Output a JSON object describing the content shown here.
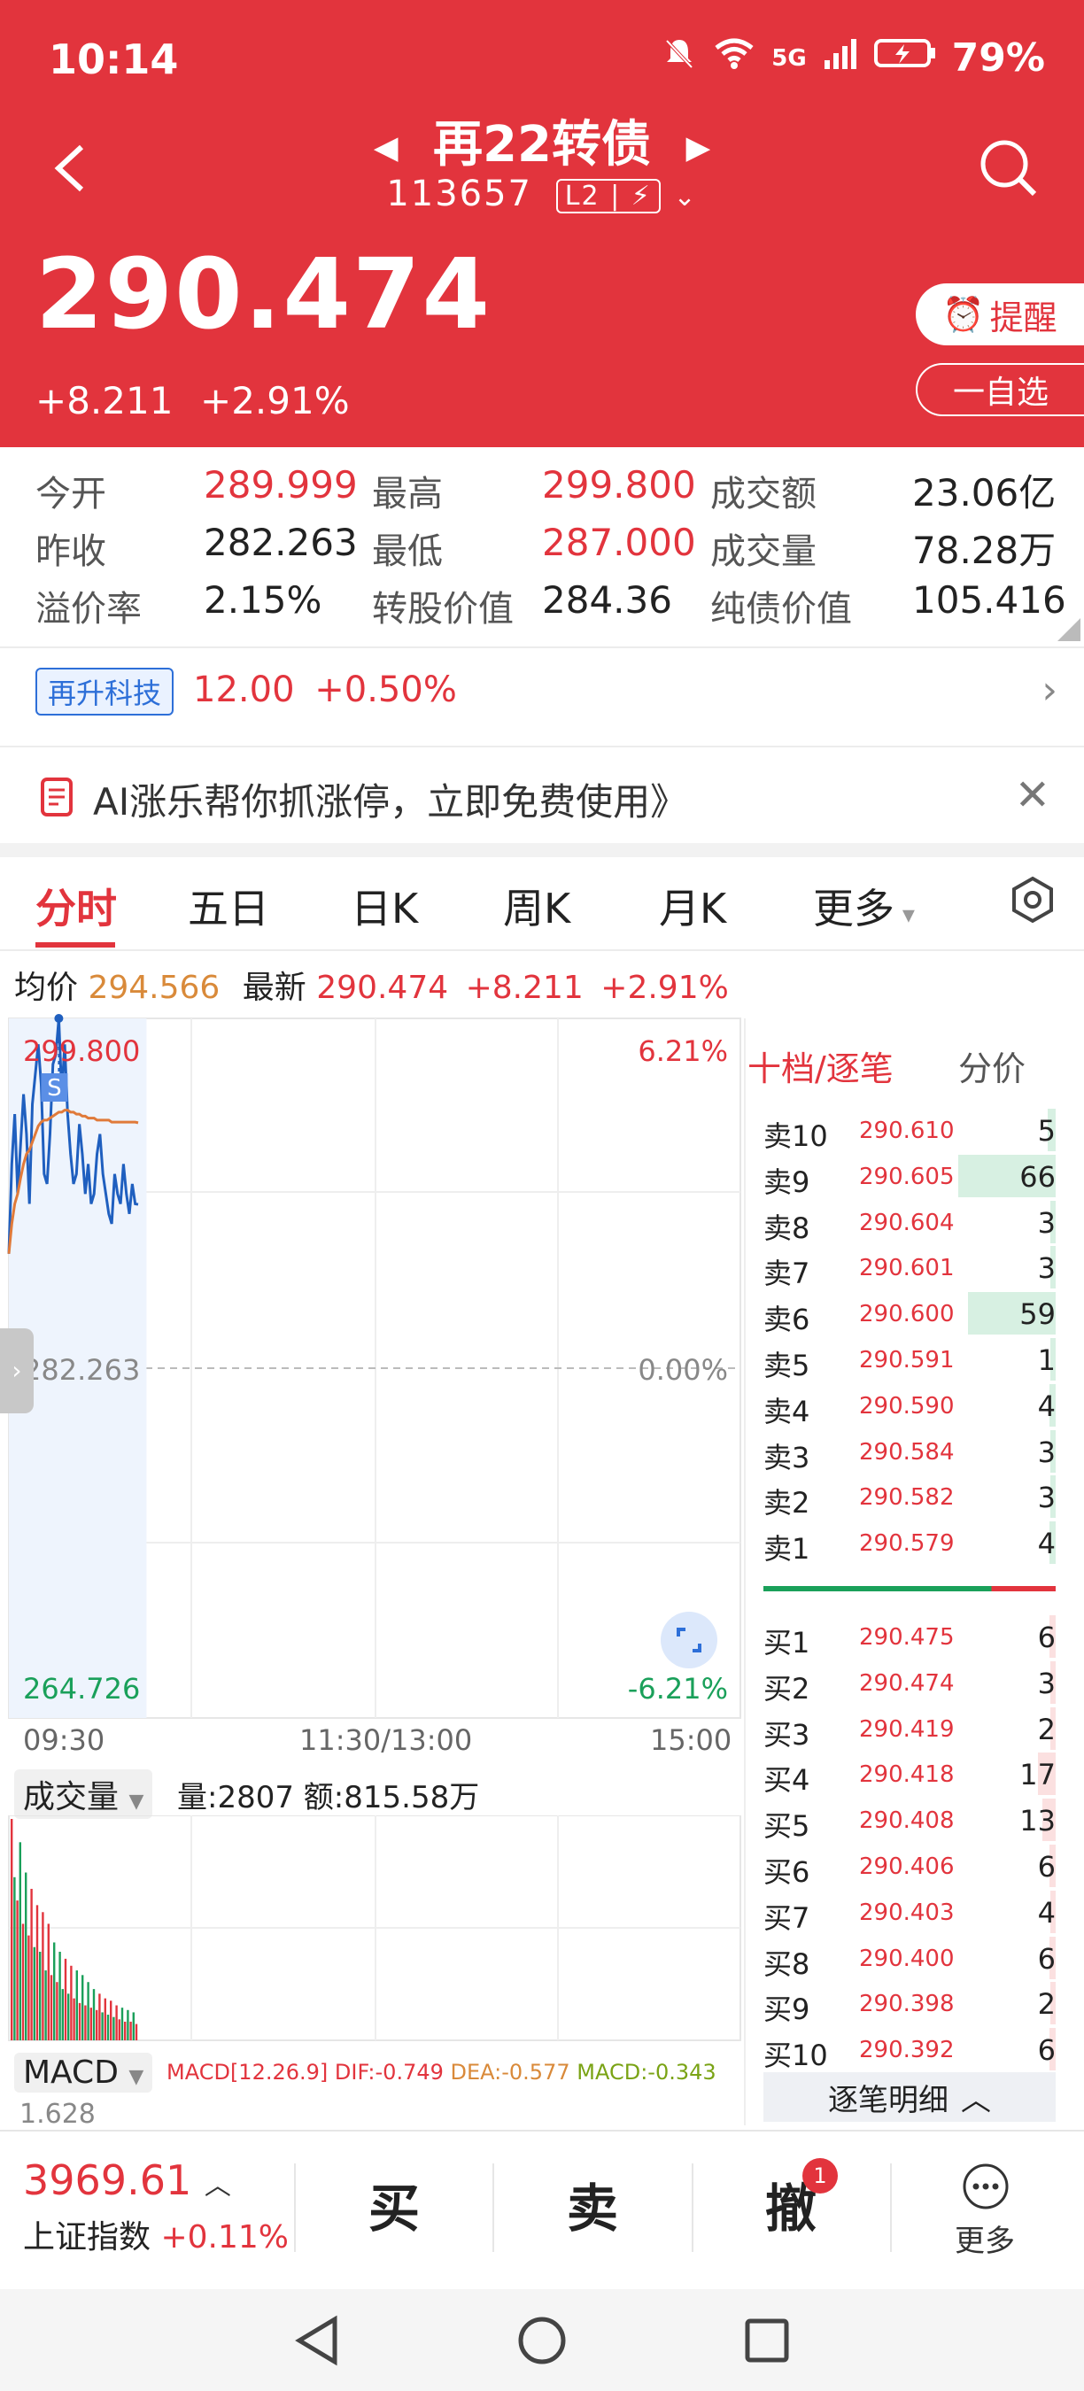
{
  "status": {
    "time": "10:14",
    "battery": "79%",
    "network": "5G"
  },
  "header": {
    "title": "再22转债",
    "code": "113657",
    "level_badge": "L2",
    "price": "290.474",
    "change": "+8.211",
    "change_pct": "+2.91%",
    "remind_label": "提醒",
    "watch_label": "一自选"
  },
  "stats": [
    {
      "label": "今开",
      "value": "289.999",
      "color": "red"
    },
    {
      "label": "最高",
      "value": "299.800",
      "color": "red"
    },
    {
      "label": "成交额",
      "value": "23.06亿",
      "color": "black"
    },
    {
      "label": "昨收",
      "value": "282.263",
      "color": "black"
    },
    {
      "label": "最低",
      "value": "287.000",
      "color": "red"
    },
    {
      "label": "成交量",
      "value": "78.28万",
      "color": "black"
    },
    {
      "label": "溢价率",
      "value": "2.15%",
      "color": "black"
    },
    {
      "label": "转股价值",
      "value": "284.36",
      "color": "black"
    },
    {
      "label": "纯债价值",
      "value": "105.416",
      "color": "black"
    }
  ],
  "related": {
    "tag": "再升科技",
    "price": "12.00",
    "pct": "+0.50%"
  },
  "ad": {
    "text": "AI涨乐帮你抓涨停，立即免费使用》"
  },
  "tabs": [
    "分时",
    "五日",
    "日K",
    "周K",
    "月K",
    "更多"
  ],
  "summary": {
    "avg_label": "均价",
    "avg_value": "294.566",
    "latest_label": "最新",
    "latest_value": "290.474",
    "latest_change": "+8.211",
    "latest_pct": "+2.91%"
  },
  "chart": {
    "y_high": "299.800",
    "y_mid": "282.263",
    "y_low": "264.726",
    "pct_high": "6.21%",
    "pct_mid": "0.00%",
    "pct_low": "-6.21%",
    "x_start": "09:30",
    "x_mid": "11:30/13:00",
    "x_end": "15:00",
    "marker": "S",
    "colors": {
      "price_line": "#1f5fbf",
      "avg_line": "#e07a3a"
    }
  },
  "chart_data": {
    "type": "line",
    "title": "",
    "xlabel": "",
    "ylabel": "",
    "ylim": [
      264.726,
      299.8
    ],
    "x": [
      "09:30",
      "09:31",
      "09:32",
      "09:33",
      "09:34",
      "09:35",
      "09:36",
      "09:37",
      "09:38",
      "09:39",
      "09:40",
      "09:41",
      "09:42",
      "09:43",
      "09:44",
      "09:45",
      "09:46",
      "09:47",
      "09:48",
      "09:49",
      "09:50",
      "09:51",
      "09:52",
      "09:53",
      "09:54",
      "09:55",
      "09:56",
      "09:57",
      "09:58",
      "09:59",
      "10:00",
      "10:01",
      "10:02",
      "10:03",
      "10:04",
      "10:05",
      "10:06",
      "10:07",
      "10:08",
      "10:09",
      "10:10",
      "10:11",
      "10:12",
      "10:13",
      "10:14"
    ],
    "series": [
      {
        "values": [
          288.0,
          292.5,
          295.0,
          291.0,
          293.5,
          296.0,
          294.0,
          290.5,
          295.5,
          297.0,
          298.5,
          296.5,
          292.0,
          291.5,
          294.0,
          297.5,
          298.0,
          299.8,
          296.0,
          298.5,
          295.0,
          293.0,
          291.5,
          292.0,
          294.5,
          293.0,
          291.0,
          292.5,
          290.5,
          291.0,
          293.0,
          294.0,
          292.0,
          291.0,
          290.0,
          289.5,
          292.0,
          291.0,
          290.5,
          292.5,
          291.0,
          290.0,
          291.5,
          290.5,
          290.474
        ]
      },
      {
        "values": [
          288.0,
          289.5,
          290.5,
          291.0,
          291.8,
          292.5,
          293.0,
          293.2,
          293.6,
          294.0,
          294.4,
          294.6,
          294.7,
          294.7,
          294.8,
          294.9,
          295.0,
          295.1,
          295.1,
          295.2,
          295.2,
          295.1,
          295.1,
          295.0,
          295.0,
          294.9,
          294.9,
          294.8,
          294.8,
          294.8,
          294.7,
          294.7,
          294.7,
          294.7,
          294.7,
          294.6,
          294.6,
          294.6,
          294.6,
          294.6,
          294.6,
          294.6,
          294.6,
          294.6,
          294.566
        ]
      }
    ]
  },
  "volume_panel": {
    "dropdown": "成交量",
    "text": "量:2807 额:815.58万"
  },
  "volume_data": {
    "values": [
      95,
      70,
      60,
      85,
      50,
      72,
      45,
      65,
      40,
      58,
      38,
      55,
      30,
      50,
      28,
      42,
      25,
      38,
      22,
      35,
      20,
      32,
      18,
      30,
      16,
      28,
      15,
      25,
      14,
      22,
      13,
      20,
      12,
      18,
      11,
      17,
      10,
      15,
      9,
      14,
      8,
      13,
      8,
      12,
      7
    ],
    "up": [
      1,
      0,
      1,
      0,
      1,
      0,
      1,
      1,
      0,
      1,
      0,
      1,
      0,
      1,
      1,
      0,
      1,
      0,
      0,
      1,
      0,
      1,
      1,
      0,
      1,
      0,
      1,
      0,
      1,
      0,
      1,
      1,
      0,
      1,
      0,
      1,
      0,
      1,
      1,
      0,
      1,
      0,
      1,
      0,
      1
    ]
  },
  "macd_panel": {
    "dropdown": "MACD",
    "params": "MACD[12.26.9]",
    "dif": "DIF:-0.749",
    "dea": "DEA:-0.577",
    "macd": "MACD:-0.343",
    "side": "1.628"
  },
  "orderbook": {
    "title": "十档/逐笔",
    "tab2": "分价",
    "asks": [
      {
        "label": "卖10",
        "price": "290.610",
        "vol": "5",
        "bar": 0.08
      },
      {
        "label": "卖9",
        "price": "290.605",
        "vol": "66",
        "bar": 1.0
      },
      {
        "label": "卖8",
        "price": "290.604",
        "vol": "3",
        "bar": 0.05
      },
      {
        "label": "卖7",
        "price": "290.601",
        "vol": "3",
        "bar": 0.05
      },
      {
        "label": "卖6",
        "price": "290.600",
        "vol": "59",
        "bar": 0.9
      },
      {
        "label": "卖5",
        "price": "290.591",
        "vol": "1",
        "bar": 0.03
      },
      {
        "label": "卖4",
        "price": "290.590",
        "vol": "4",
        "bar": 0.06
      },
      {
        "label": "卖3",
        "price": "290.584",
        "vol": "3",
        "bar": 0.05
      },
      {
        "label": "卖2",
        "price": "290.582",
        "vol": "3",
        "bar": 0.05
      },
      {
        "label": "卖1",
        "price": "290.579",
        "vol": "4",
        "bar": 0.06
      }
    ],
    "bids": [
      {
        "label": "买1",
        "price": "290.475",
        "vol": "6",
        "bar": 0.06
      },
      {
        "label": "买2",
        "price": "290.474",
        "vol": "3",
        "bar": 0.05
      },
      {
        "label": "买3",
        "price": "290.419",
        "vol": "2",
        "bar": 0.04
      },
      {
        "label": "买4",
        "price": "290.418",
        "vol": "17",
        "bar": 0.18
      },
      {
        "label": "买5",
        "price": "290.408",
        "vol": "13",
        "bar": 0.14
      },
      {
        "label": "买6",
        "price": "290.406",
        "vol": "6",
        "bar": 0.06
      },
      {
        "label": "买7",
        "price": "290.403",
        "vol": "4",
        "bar": 0.05
      },
      {
        "label": "买8",
        "price": "290.400",
        "vol": "6",
        "bar": 0.06
      },
      {
        "label": "买9",
        "price": "290.398",
        "vol": "2",
        "bar": 0.04
      },
      {
        "label": "买10",
        "price": "290.392",
        "vol": "6",
        "bar": 0.06
      }
    ],
    "detail_label": "逐笔明细"
  },
  "bottom": {
    "index_value": "3969.61",
    "index_name": "上证指数",
    "index_pct": "+0.11%",
    "buy": "买",
    "sell": "卖",
    "cancel": "撤",
    "cancel_badge": "1",
    "more": "更多"
  }
}
